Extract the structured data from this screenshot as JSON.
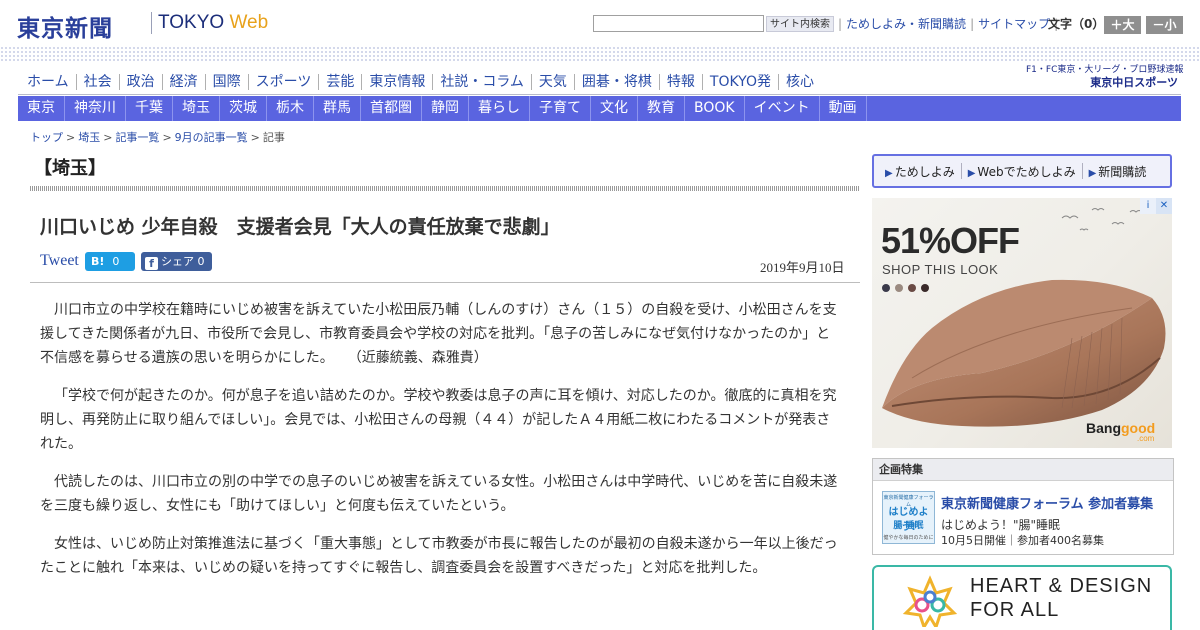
{
  "header": {
    "logo_kanji": "東京新聞",
    "logo_tokyo": "TOKYO",
    "logo_web": "Web",
    "search_placeholder": "",
    "search_button": "サイト内検索",
    "util_links": [
      "ためしよみ・新聞購読",
      "サイトマップ"
    ],
    "font_size_label": "文字（0）",
    "font_large": "＋大",
    "font_small": "－小"
  },
  "main_nav": [
    "ホーム",
    "社会",
    "政治",
    "経済",
    "国際",
    "スポーツ",
    "芸能",
    "東京情報",
    "社説・コラム",
    "天気",
    "囲碁・将棋",
    "特報",
    "TOKYO発",
    "核心"
  ],
  "sports_ad": {
    "line1": "F1・FC東京・大リーグ・プロ野球速報",
    "line2": "東京中日スポーツ"
  },
  "region_nav": [
    "東京",
    "神奈川",
    "千葉",
    "埼玉",
    "茨城",
    "栃木",
    "群馬",
    "首都圏",
    "静岡",
    "暮らし",
    "子育て",
    "文化",
    "教育",
    "BOOK",
    "イベント",
    "動画"
  ],
  "breadcrumb": [
    "トップ",
    "埼玉",
    "記事一覧",
    "9月の記事一覧",
    "記事"
  ],
  "article": {
    "section": "【埼玉】",
    "title": "川口いじめ 少年自殺　支援者会見「大人の責任放棄で悲劇」",
    "tweet": "Tweet",
    "hatena_label": "B!",
    "hatena_count": "0",
    "facebook_label": "シェア",
    "facebook_count": "0",
    "date": "2019年9月10日",
    "paragraphs": [
      "川口市立の中学校在籍時にいじめ被害を訴えていた小松田辰乃輔（しんのすけ）さん（１５）の自殺を受け、小松田さんを支援してきた関係者が九日、市役所で会見し、市教育委員会や学校の対応を批判。「息子の苦しみになぜ気付けなかったのか」と不信感を募らせる遺族の思いを明らかにした。　　（近藤統義、森雅貴）",
      "「学校で何が起きたのか。何が息子を追い詰めたのか。学校や教委は息子の声に耳を傾け、対応したのか。徹底的に真相を究明し、再発防止に取り組んでほしい」。会見では、小松田さんの母親（４４）が記したＡ４用紙二枚にわたるコメントが発表された。",
      "代読したのは、川口市立の別の中学での息子のいじめ被害を訴えている女性。小松田さんは中学時代、いじめを苦に自殺未遂を三度も繰り返し、女性にも「助けてほしい」と何度も伝えていたという。",
      "女性は、いじめ防止対策推進法に基づく「重大事態」として市教委が市長に報告したのが最初の自殺未遂から一年以上後だったことに触れ「本来は、いじめの疑いを持ってすぐに報告し、調査委員会を設置すべきだった」と対応を批判した。"
    ]
  },
  "sidebar": {
    "subscribe": [
      "ためしよみ",
      "Webでためしよみ",
      "新聞購読"
    ],
    "ad": {
      "headline": "51%OFF",
      "sub": "SHOP THIS LOOK",
      "brand_a": "Bang",
      "brand_b": "good",
      "brand_sub": ".com",
      "close": "✕",
      "info": "i",
      "dot_colors": [
        "#3a3a4a",
        "#9a8a80",
        "#6a4a44",
        "#3a2a2a"
      ]
    },
    "feature": {
      "header": "企画特集",
      "thumb_t1": "東京新聞健康フォーラム",
      "thumb_t2": "はじめよう!",
      "thumb_t3": "腸 睡眠",
      "thumb_t4": "健やかな毎日のために",
      "title": "東京新聞健康フォーラム 参加者募集",
      "line1": "はじめよう！\"腸\"睡眠",
      "line2": "10月5日開催｜参加者400名募集"
    },
    "banner": {
      "text1": "HEART & DESIGN",
      "text2": "FOR ALL"
    }
  },
  "colors": {
    "brand_blue": "#2a3f9a",
    "link_blue": "#2a4da8",
    "region_nav_bg": "#5a64e0",
    "web_orange": "#e8a21c",
    "banner_teal": "#3ab8a6"
  }
}
